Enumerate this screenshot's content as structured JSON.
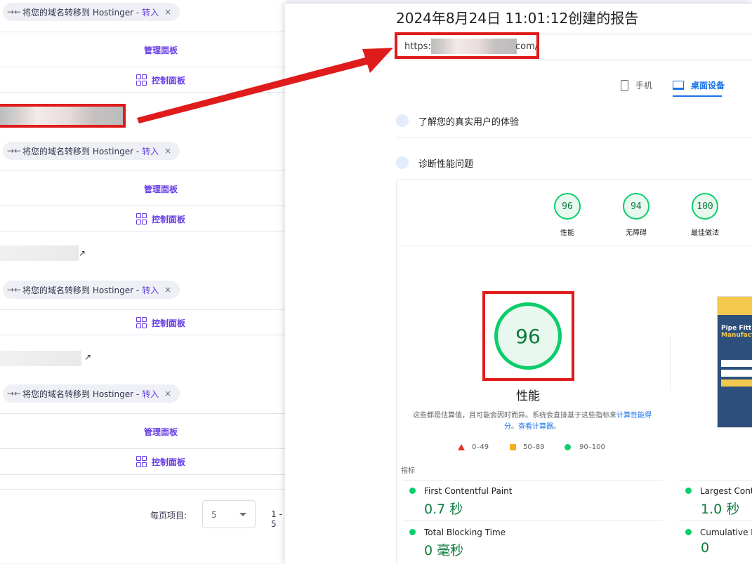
{
  "left": {
    "chip": {
      "text": "将您的域名转移到 Hostinger -",
      "action": "转入",
      "close": "×",
      "icon": "transfer-icon"
    },
    "manage_label": "管理面板",
    "control_label": "控制面板",
    "pagination": {
      "label": "每页项目:",
      "value": "5",
      "range": "1 - 5"
    }
  },
  "report": {
    "title": "2024年8月24日 11:01:12创建的报告",
    "url_prefix": "https:/",
    "url_suffix": "com/",
    "tabs": {
      "mobile": "手机",
      "desktop": "桌面设备"
    },
    "sections": {
      "field": "了解您的真实用户的体验",
      "diag": "诊断性能问题"
    },
    "gauges": [
      {
        "score": "96",
        "label": "性能"
      },
      {
        "score": "94",
        "label": "无障碍"
      },
      {
        "score": "100",
        "label": "最佳做法"
      }
    ],
    "big_gauge": {
      "score": "96",
      "label": "性能"
    },
    "note_text": "这些都是估算值，且可能会因时而异。系统会直接基于这些指标来",
    "note_link1": "计算性能得分",
    "note_link2": "查看计算器",
    "note_dot": "。",
    "legend": {
      "low": "0–49",
      "mid": "50–89",
      "high": "90–100"
    },
    "metrics_heading": "指标",
    "metrics": [
      {
        "name": "First Contentful Paint",
        "value": "0.7 秒"
      },
      {
        "name": "Largest Conte",
        "value": "1.0 秒"
      },
      {
        "name": "Total Blocking Time",
        "value": "0 毫秒"
      },
      {
        "name": "Cumulative La",
        "value": "0"
      }
    ],
    "thumb": {
      "line1": "Pipe Fittin",
      "line2": "Manufact"
    }
  },
  "colors": {
    "accent": "#673de6",
    "good": "#0cce6b",
    "highlight": "#e01b1b",
    "link": "#1a73e8"
  }
}
